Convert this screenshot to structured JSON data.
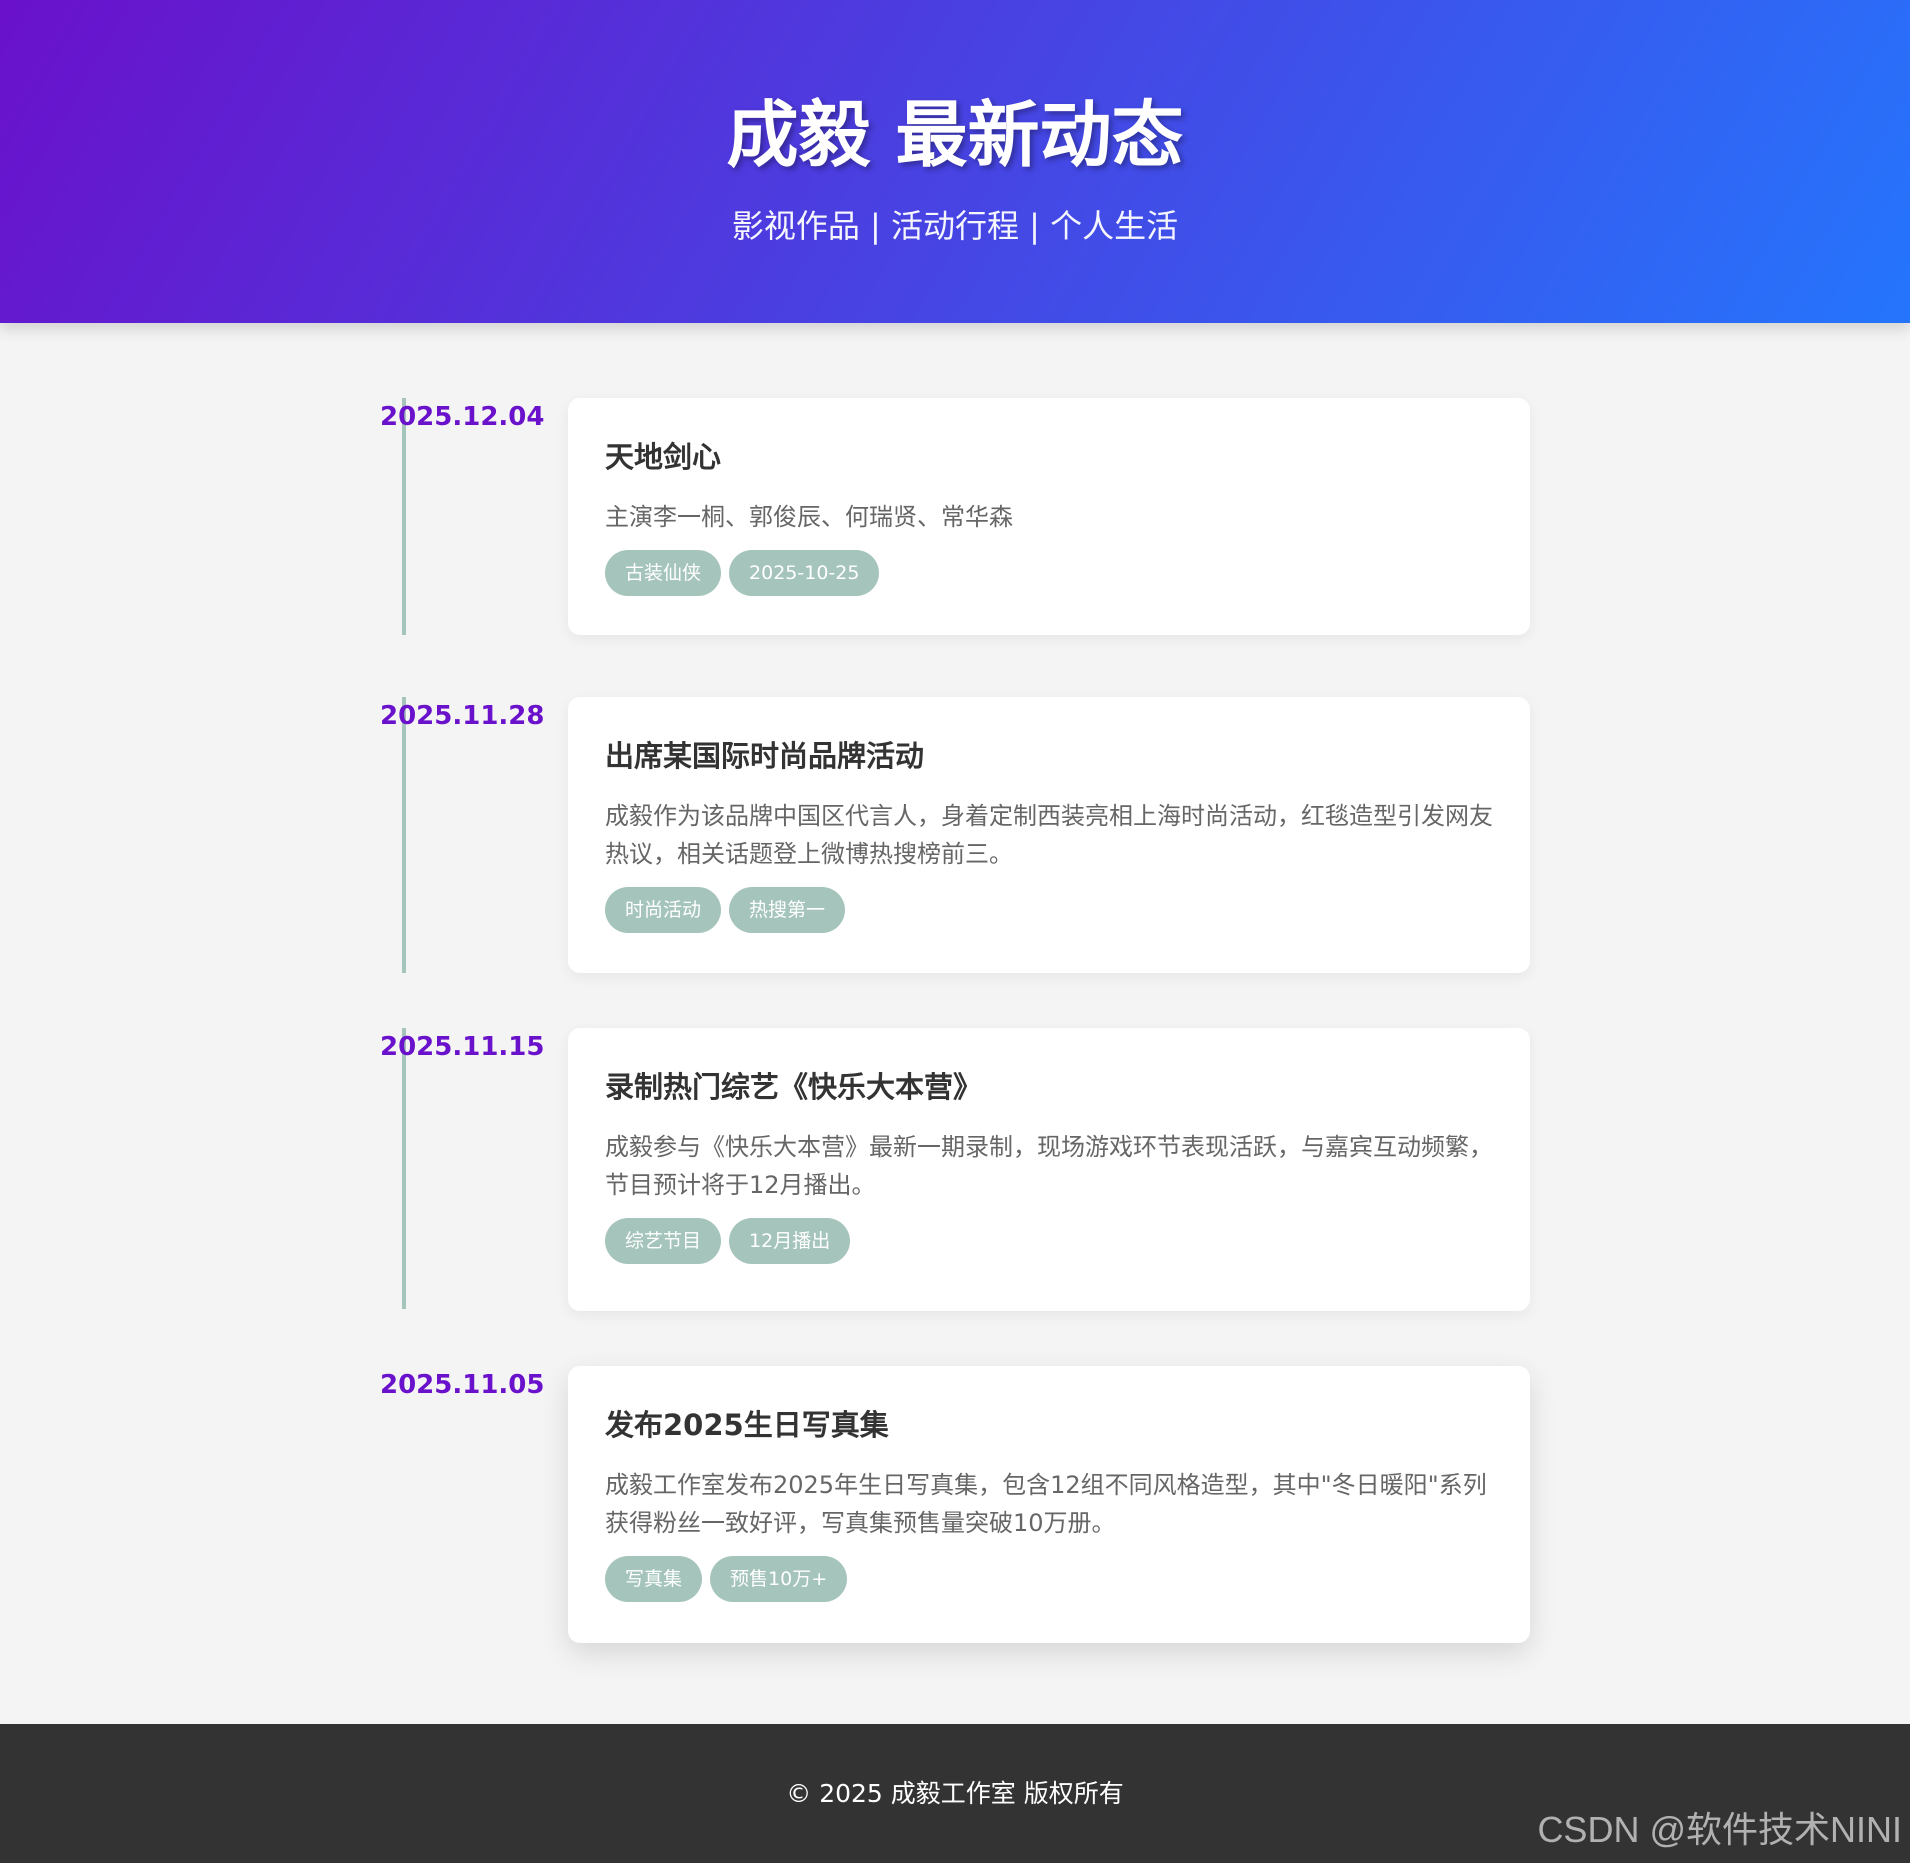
{
  "header": {
    "title": "成毅 最新动态",
    "subtitle": "影视作品 | 活动行程 | 个人生活"
  },
  "timeline": [
    {
      "date": "2025.12.04",
      "title": "天地剑心",
      "description": "主演李一桐、郭俊辰、何瑞贤、常华森",
      "tags": [
        "古装仙侠",
        "2025-10-25"
      ]
    },
    {
      "date": "2025.11.28",
      "title": "出席某国际时尚品牌活动",
      "description": "成毅作为该品牌中国区代言人，身着定制西装亮相上海时尚活动，红毯造型引发网友热议，相关话题登上微博热搜榜前三。",
      "tags": [
        "时尚活动",
        "热搜第一"
      ]
    },
    {
      "date": "2025.11.15",
      "title": "录制热门综艺《快乐大本营》",
      "description": "成毅参与《快乐大本营》最新一期录制，现场游戏环节表现活跃，与嘉宾互动频繁，节目预计将于12月播出。",
      "tags": [
        "综艺节目",
        "12月播出"
      ]
    },
    {
      "date": "2025.11.05",
      "title": "发布2025生日写真集",
      "description": "成毅工作室发布2025年生日写真集，包含12组不同风格造型，其中\"冬日暖阳\"系列获得粉丝一致好评，写真集预售量突破10万册。",
      "tags": [
        "写真集",
        "预售10万+"
      ]
    }
  ],
  "footer": {
    "copyright": "© 2025 成毅工作室 版权所有"
  },
  "watermark": "CSDN @软件技术NINI",
  "colors": {
    "accent": "#6a11cb",
    "gradient_end": "#2575fc",
    "tag_bg": "#a5c4bb",
    "footer_bg": "#333333"
  }
}
